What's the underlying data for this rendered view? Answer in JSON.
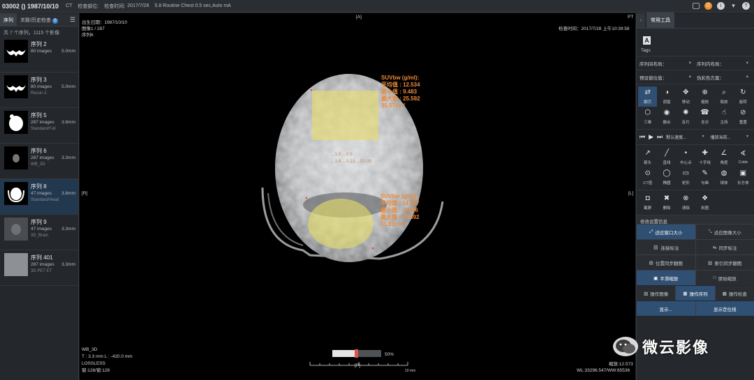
{
  "topbar": {
    "patient": "03002 () 1987/10/10",
    "modality": "CT",
    "body_part_label": "检查部位:",
    "study_time_label": "检查时间:",
    "study_date": "2017/7/28",
    "series_desc": "5.8 Routine Chest 0.5 sec,Auto mA"
  },
  "left": {
    "tab_series": "序列",
    "tab_history": "关联/历史检查",
    "history_badge": "0",
    "summary": "共 7 个序列，1115 个影像",
    "series": [
      {
        "name": "序列 2",
        "images": "80 images",
        "thickness": "5.0mm",
        "desc": ""
      },
      {
        "name": "序列 3",
        "images": "80 images",
        "thickness": "5.0mm",
        "desc": "Recon 2:"
      },
      {
        "name": "序列 5",
        "images": "287 images",
        "thickness": "3.8mm",
        "desc": "Standard/Full"
      },
      {
        "name": "序列 6",
        "images": "287 images",
        "thickness": "3.3mm",
        "desc": "WB_3D"
      },
      {
        "name": "序列 8",
        "images": "47 images",
        "thickness": "3.8mm",
        "desc": "Standard/Head"
      },
      {
        "name": "序列 9",
        "images": "47 images",
        "thickness": "3.3mm",
        "desc": "3D_Brain"
      },
      {
        "name": "序列 401",
        "images": "287 images",
        "thickness": "3.3mm",
        "desc": "3D PET ET"
      }
    ]
  },
  "viewer": {
    "top_marker": "[A]",
    "bottom_marker": "[P]",
    "left_marker": "[R]",
    "right_marker": "[L]",
    "pt_label": "PT",
    "birth": "出生日期：1987/10/10",
    "image_index": "图像1 / 287",
    "series_index": "序列6",
    "study_time": "检查时间：2017/7/28 上午10:39:58",
    "bottom_left_1": "WB_3D",
    "bottom_left_2": "T : 3.3 mm L : -420.0 mm",
    "bottom_left_3": "LOSSLESS",
    "bottom_left_4": "窗:128/窗:128",
    "zoom": "缩放:12.573",
    "wlww": "WL:33296.547/WW:65536",
    "slider_pct": "50%",
    "scale_unit": "10 mm",
    "roi1": [
      "SUVbw (g/ml):",
      "平均值 : 12.534",
      "最小值 : 9.483",
      "最大值 : 25.592",
      "35.57cm²"
    ],
    "roi2": [
      "SUVbw (g/ml):",
      "平均值 : 14.887",
      "最小值 : -0.406",
      "最大值 : 25.592",
      "31.91cm²"
    ],
    "faint": [
      "...1.0 ...0.5",
      "...1.8 ...0.13 ...52.09"
    ]
  },
  "right": {
    "tab": "常用工具",
    "tags_label": "Tags",
    "dd_series_layout": "序列间布局：",
    "dd_in_series_layout": "序列内布局：",
    "dd_window_preset": "预设窗位值：",
    "dd_pseudo_color": "伪彩色方案：",
    "tools_row1": [
      {
        "icon": "⇄",
        "label": "翻页",
        "name": "page-icon"
      },
      {
        "icon": "◑",
        "label": "调窗",
        "name": "window-icon"
      },
      {
        "icon": "✥",
        "label": "移动",
        "name": "move-icon"
      },
      {
        "icon": "⊕",
        "label": "缩放",
        "name": "zoom-icon"
      },
      {
        "icon": "⌕",
        "label": "局放",
        "name": "magnify-icon"
      },
      {
        "icon": "↻",
        "label": "旋转",
        "name": "rotate-icon"
      }
    ],
    "tools_row2": [
      {
        "icon": "⬡",
        "label": "三维",
        "name": "3d-icon"
      },
      {
        "icon": "◉",
        "label": "融合",
        "name": "fusion-icon"
      },
      {
        "icon": "✺",
        "label": "反片",
        "name": "invert-icon"
      },
      {
        "icon": "☎",
        "label": "全诊",
        "name": "diagnose-icon"
      },
      {
        "icon": "☝",
        "label": "主持",
        "name": "host-icon"
      },
      {
        "icon": "⊘",
        "label": "重置",
        "name": "reset-icon"
      }
    ],
    "play_speed": "默认速度...",
    "play_current": "播放当前...",
    "tools_row3": [
      {
        "icon": "↗",
        "label": "箭头",
        "name": "arrow-icon"
      },
      {
        "icon": "╱",
        "label": "直线",
        "name": "line-icon"
      },
      {
        "icon": "•",
        "label": "中心点",
        "name": "center-point-icon"
      },
      {
        "icon": "✚",
        "label": "十字线",
        "name": "crosshair-icon"
      },
      {
        "icon": "∠",
        "label": "角度",
        "name": "angle-icon"
      },
      {
        "icon": "∢",
        "label": "Cobb",
        "name": "cobb-icon"
      }
    ],
    "tools_row4": [
      {
        "icon": "⊙",
        "label": "CT值",
        "name": "ct-value-icon"
      },
      {
        "icon": "◯",
        "label": "椭圆",
        "name": "ellipse-icon"
      },
      {
        "icon": "▭",
        "label": "矩形",
        "name": "rectangle-icon"
      },
      {
        "icon": "✎",
        "label": "勾画",
        "name": "draw-icon"
      },
      {
        "icon": "◍",
        "label": "球体",
        "name": "sphere-icon"
      },
      {
        "icon": "▣",
        "label": "长方体",
        "name": "cuboid-icon"
      }
    ],
    "tools_row5": [
      {
        "icon": "📷",
        "label": "截屏",
        "name": "screenshot-icon"
      },
      {
        "icon": "✖",
        "label": "删除",
        "name": "delete-icon"
      },
      {
        "icon": "⊗",
        "label": "清除",
        "name": "clear-icon"
      },
      {
        "icon": "❖",
        "label": "拆图",
        "name": "split-icon"
      }
    ],
    "section_title": "修改设置信息",
    "btn_fit_window": "适应窗口大小",
    "btn_fit_image": "适应图像大小",
    "btn_link_mark": "连接标注",
    "btn_sync_mark": "同步标注",
    "btn_pos_sync": "位置同步翻图",
    "btn_idx_sync": "索引同步翻图",
    "btn_smooth_zoom": "平滑缩放",
    "btn_orig_zoom": "原始缩放",
    "btn_op_image": "操作图像",
    "btn_op_series": "操作序列",
    "btn_op_study": "操作检查",
    "btn_show_label": "显示...",
    "btn_show_loc": "显示定位线"
  },
  "watermark": {
    "text": "微云影像"
  }
}
